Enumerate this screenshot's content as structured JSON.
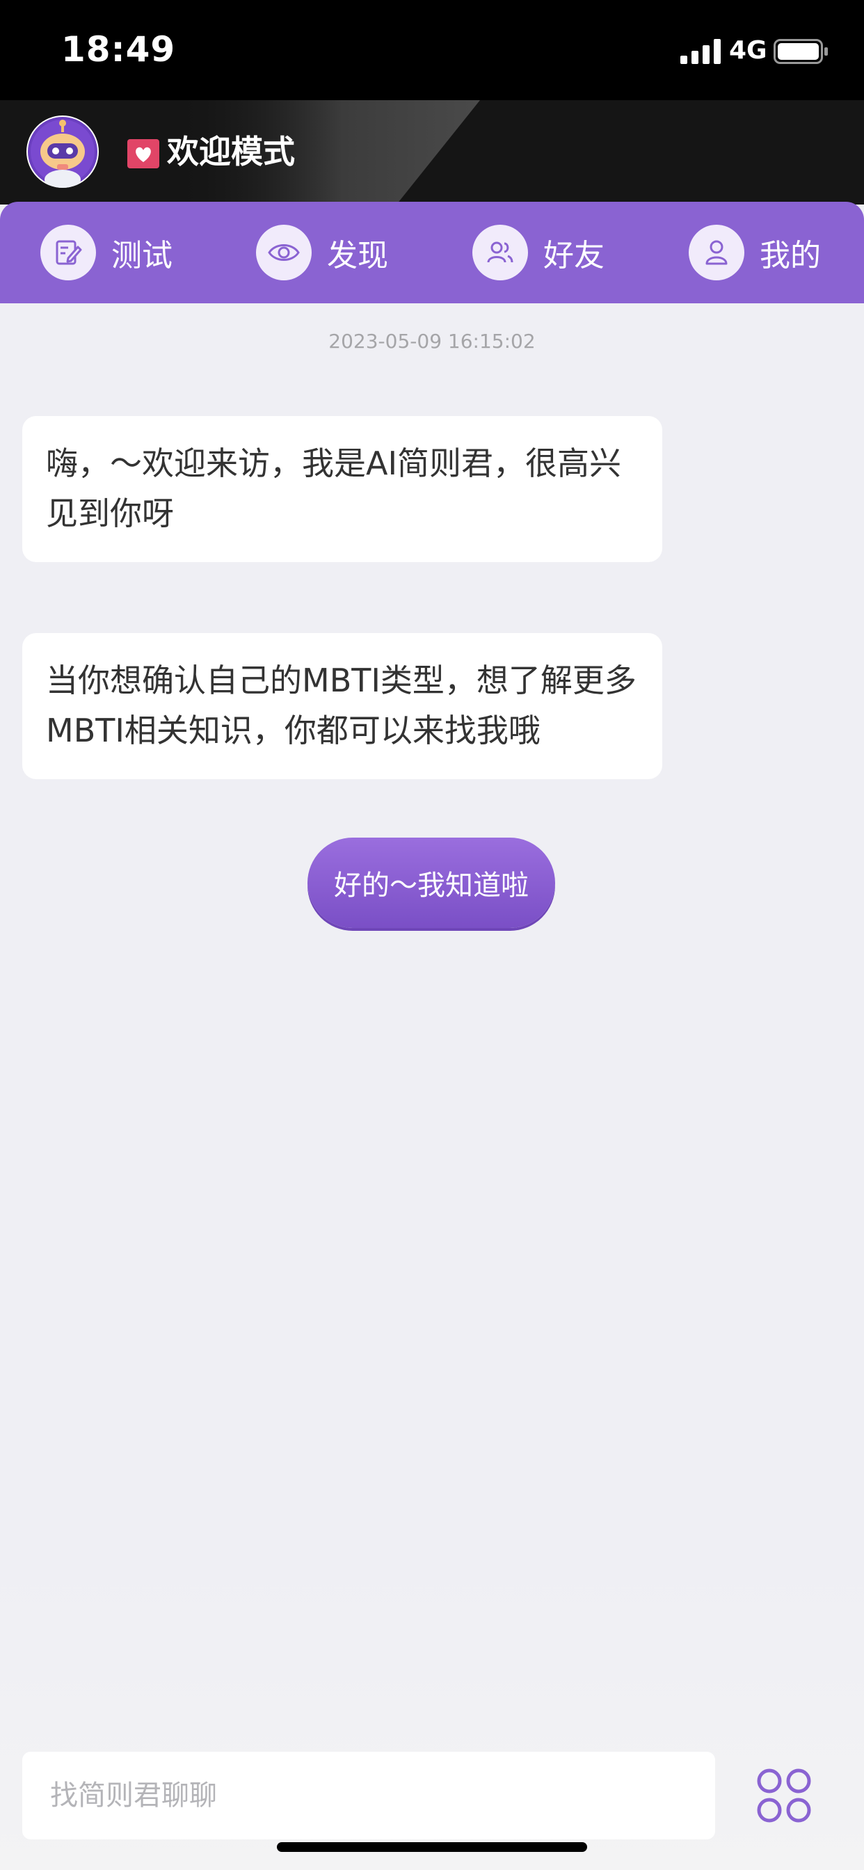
{
  "status_bar": {
    "time": "18:49",
    "network": "4G"
  },
  "header": {
    "mode_title": "欢迎模式",
    "icons": {
      "avatar": "robot-avatar",
      "mode": "heart-icon"
    }
  },
  "tabs": [
    {
      "label": "测试",
      "icon": "edit-icon"
    },
    {
      "label": "发现",
      "icon": "eye-icon"
    },
    {
      "label": "好友",
      "icon": "friends-icon"
    },
    {
      "label": "我的",
      "icon": "user-icon"
    }
  ],
  "chat": {
    "timestamp": "2023-05-09 16:15:02",
    "messages": [
      {
        "text": "嗨，～欢迎来访，我是AI简则君，很高兴见到你呀"
      },
      {
        "text": "当你想确认自己的MBTI类型，想了解更多MBTI相关知识，你都可以来找我哦"
      }
    ],
    "reply_button": "好的～我知道啦"
  },
  "input": {
    "placeholder": "找简则君聊聊",
    "value": ""
  },
  "colors": {
    "accent": "#8a63d2",
    "header_bg": "#151515",
    "page_bg": "#efeff4"
  }
}
